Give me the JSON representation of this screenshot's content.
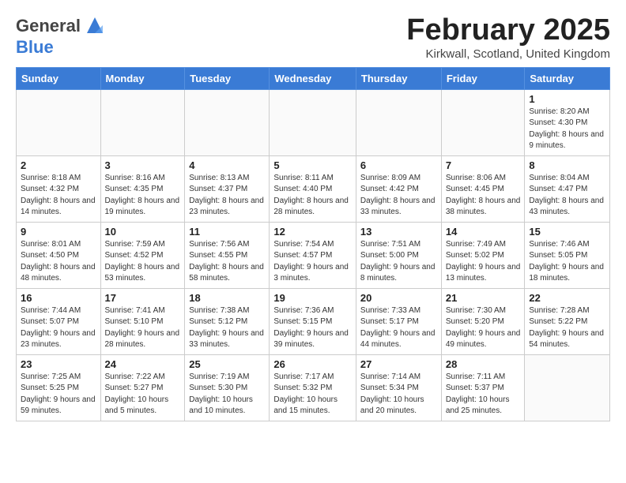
{
  "header": {
    "logo_general": "General",
    "logo_blue": "Blue",
    "month_title": "February 2025",
    "location": "Kirkwall, Scotland, United Kingdom"
  },
  "weekdays": [
    "Sunday",
    "Monday",
    "Tuesday",
    "Wednesday",
    "Thursday",
    "Friday",
    "Saturday"
  ],
  "weeks": [
    [
      {
        "day": "",
        "info": ""
      },
      {
        "day": "",
        "info": ""
      },
      {
        "day": "",
        "info": ""
      },
      {
        "day": "",
        "info": ""
      },
      {
        "day": "",
        "info": ""
      },
      {
        "day": "",
        "info": ""
      },
      {
        "day": "1",
        "info": "Sunrise: 8:20 AM\nSunset: 4:30 PM\nDaylight: 8 hours and 9 minutes."
      }
    ],
    [
      {
        "day": "2",
        "info": "Sunrise: 8:18 AM\nSunset: 4:32 PM\nDaylight: 8 hours and 14 minutes."
      },
      {
        "day": "3",
        "info": "Sunrise: 8:16 AM\nSunset: 4:35 PM\nDaylight: 8 hours and 19 minutes."
      },
      {
        "day": "4",
        "info": "Sunrise: 8:13 AM\nSunset: 4:37 PM\nDaylight: 8 hours and 23 minutes."
      },
      {
        "day": "5",
        "info": "Sunrise: 8:11 AM\nSunset: 4:40 PM\nDaylight: 8 hours and 28 minutes."
      },
      {
        "day": "6",
        "info": "Sunrise: 8:09 AM\nSunset: 4:42 PM\nDaylight: 8 hours and 33 minutes."
      },
      {
        "day": "7",
        "info": "Sunrise: 8:06 AM\nSunset: 4:45 PM\nDaylight: 8 hours and 38 minutes."
      },
      {
        "day": "8",
        "info": "Sunrise: 8:04 AM\nSunset: 4:47 PM\nDaylight: 8 hours and 43 minutes."
      }
    ],
    [
      {
        "day": "9",
        "info": "Sunrise: 8:01 AM\nSunset: 4:50 PM\nDaylight: 8 hours and 48 minutes."
      },
      {
        "day": "10",
        "info": "Sunrise: 7:59 AM\nSunset: 4:52 PM\nDaylight: 8 hours and 53 minutes."
      },
      {
        "day": "11",
        "info": "Sunrise: 7:56 AM\nSunset: 4:55 PM\nDaylight: 8 hours and 58 minutes."
      },
      {
        "day": "12",
        "info": "Sunrise: 7:54 AM\nSunset: 4:57 PM\nDaylight: 9 hours and 3 minutes."
      },
      {
        "day": "13",
        "info": "Sunrise: 7:51 AM\nSunset: 5:00 PM\nDaylight: 9 hours and 8 minutes."
      },
      {
        "day": "14",
        "info": "Sunrise: 7:49 AM\nSunset: 5:02 PM\nDaylight: 9 hours and 13 minutes."
      },
      {
        "day": "15",
        "info": "Sunrise: 7:46 AM\nSunset: 5:05 PM\nDaylight: 9 hours and 18 minutes."
      }
    ],
    [
      {
        "day": "16",
        "info": "Sunrise: 7:44 AM\nSunset: 5:07 PM\nDaylight: 9 hours and 23 minutes."
      },
      {
        "day": "17",
        "info": "Sunrise: 7:41 AM\nSunset: 5:10 PM\nDaylight: 9 hours and 28 minutes."
      },
      {
        "day": "18",
        "info": "Sunrise: 7:38 AM\nSunset: 5:12 PM\nDaylight: 9 hours and 33 minutes."
      },
      {
        "day": "19",
        "info": "Sunrise: 7:36 AM\nSunset: 5:15 PM\nDaylight: 9 hours and 39 minutes."
      },
      {
        "day": "20",
        "info": "Sunrise: 7:33 AM\nSunset: 5:17 PM\nDaylight: 9 hours and 44 minutes."
      },
      {
        "day": "21",
        "info": "Sunrise: 7:30 AM\nSunset: 5:20 PM\nDaylight: 9 hours and 49 minutes."
      },
      {
        "day": "22",
        "info": "Sunrise: 7:28 AM\nSunset: 5:22 PM\nDaylight: 9 hours and 54 minutes."
      }
    ],
    [
      {
        "day": "23",
        "info": "Sunrise: 7:25 AM\nSunset: 5:25 PM\nDaylight: 9 hours and 59 minutes."
      },
      {
        "day": "24",
        "info": "Sunrise: 7:22 AM\nSunset: 5:27 PM\nDaylight: 10 hours and 5 minutes."
      },
      {
        "day": "25",
        "info": "Sunrise: 7:19 AM\nSunset: 5:30 PM\nDaylight: 10 hours and 10 minutes."
      },
      {
        "day": "26",
        "info": "Sunrise: 7:17 AM\nSunset: 5:32 PM\nDaylight: 10 hours and 15 minutes."
      },
      {
        "day": "27",
        "info": "Sunrise: 7:14 AM\nSunset: 5:34 PM\nDaylight: 10 hours and 20 minutes."
      },
      {
        "day": "28",
        "info": "Sunrise: 7:11 AM\nSunset: 5:37 PM\nDaylight: 10 hours and 25 minutes."
      },
      {
        "day": "",
        "info": ""
      }
    ]
  ]
}
